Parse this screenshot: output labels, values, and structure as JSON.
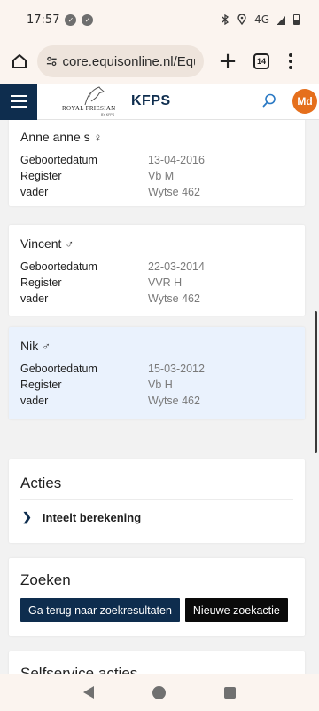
{
  "status_bar": {
    "time": "17:57",
    "network": "4G"
  },
  "browser": {
    "url": "core.equisonline.nl/Equis",
    "tab_count": "14"
  },
  "header": {
    "logo_small": "ROYAL FRIESIAN",
    "logo_by": "BY KFPS",
    "brand": "KFPS",
    "avatar_initials": "Md"
  },
  "horses": [
    {
      "name": "Anne anne s",
      "gender_symbol": "♀",
      "birth_label": "Geboortedatum",
      "birth": "13-04-2016",
      "register_label": "Register",
      "register": "Vb M",
      "sire_label": "vader",
      "sire": "Wytse 462"
    },
    {
      "name": "Vincent",
      "gender_symbol": "♂",
      "birth_label": "Geboortedatum",
      "birth": "22-03-2014",
      "register_label": "Register",
      "register": "VVR H",
      "sire_label": "vader",
      "sire": "Wytse 462"
    },
    {
      "name": "Nik",
      "gender_symbol": "♂",
      "birth_label": "Geboortedatum",
      "birth": "15-03-2012",
      "register_label": "Register",
      "register": "Vb H",
      "sire_label": "vader",
      "sire": "Wytse 462"
    }
  ],
  "acties": {
    "title": "Acties",
    "item": "Inteelt berekening"
  },
  "zoeken": {
    "title": "Zoeken",
    "back_button": "Ga terug naar zoekresultaten",
    "new_button": "Nieuwe zoekactie"
  },
  "selfservice": {
    "title": "Selfservice acties"
  },
  "colors": {
    "brand_navy": "#0e2d4e",
    "avatar_orange": "#e56f1c",
    "active_card": "#eaf2fd"
  }
}
